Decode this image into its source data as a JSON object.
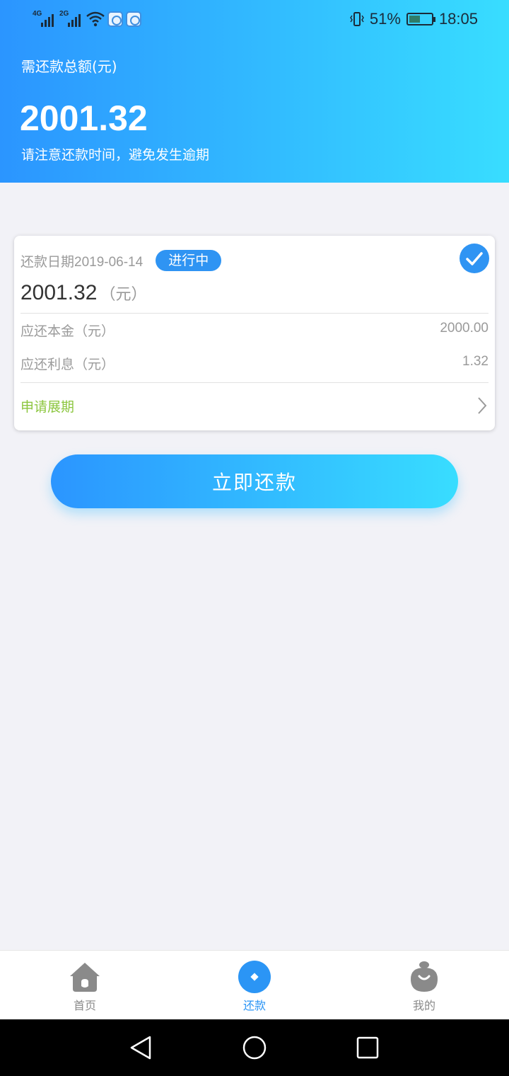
{
  "status_bar": {
    "network1": "4G",
    "network2": "2G",
    "battery_text": "51%",
    "battery_level": 0.51,
    "time": "18:05"
  },
  "header": {
    "label": "需还款总额(元)",
    "amount": "2001.32",
    "note": "请注意还款时间，避免发生逾期"
  },
  "card": {
    "date_label": "还款日期2019-06-14",
    "status_badge": "进行中",
    "amount": "2001.32",
    "amount_unit": "（元）",
    "rows": [
      {
        "label": "应还本金（元）",
        "value": "2000.00"
      },
      {
        "label": "应还利息（元）",
        "value": "1.32"
      }
    ],
    "extend_label": "申请展期"
  },
  "repay_button": "立即还款",
  "tabs": [
    {
      "label": "首页",
      "icon": "home-icon",
      "active": false
    },
    {
      "label": "还款",
      "icon": "repay-icon",
      "active": true
    },
    {
      "label": "我的",
      "icon": "profile-icon",
      "active": false
    }
  ],
  "colors": {
    "primary": "#2b95ff",
    "gradient_end": "#38ddff",
    "accent_green": "#8cc63f",
    "badge_blue": "#2f94f3",
    "inactive_gray": "#8a8a8a"
  }
}
